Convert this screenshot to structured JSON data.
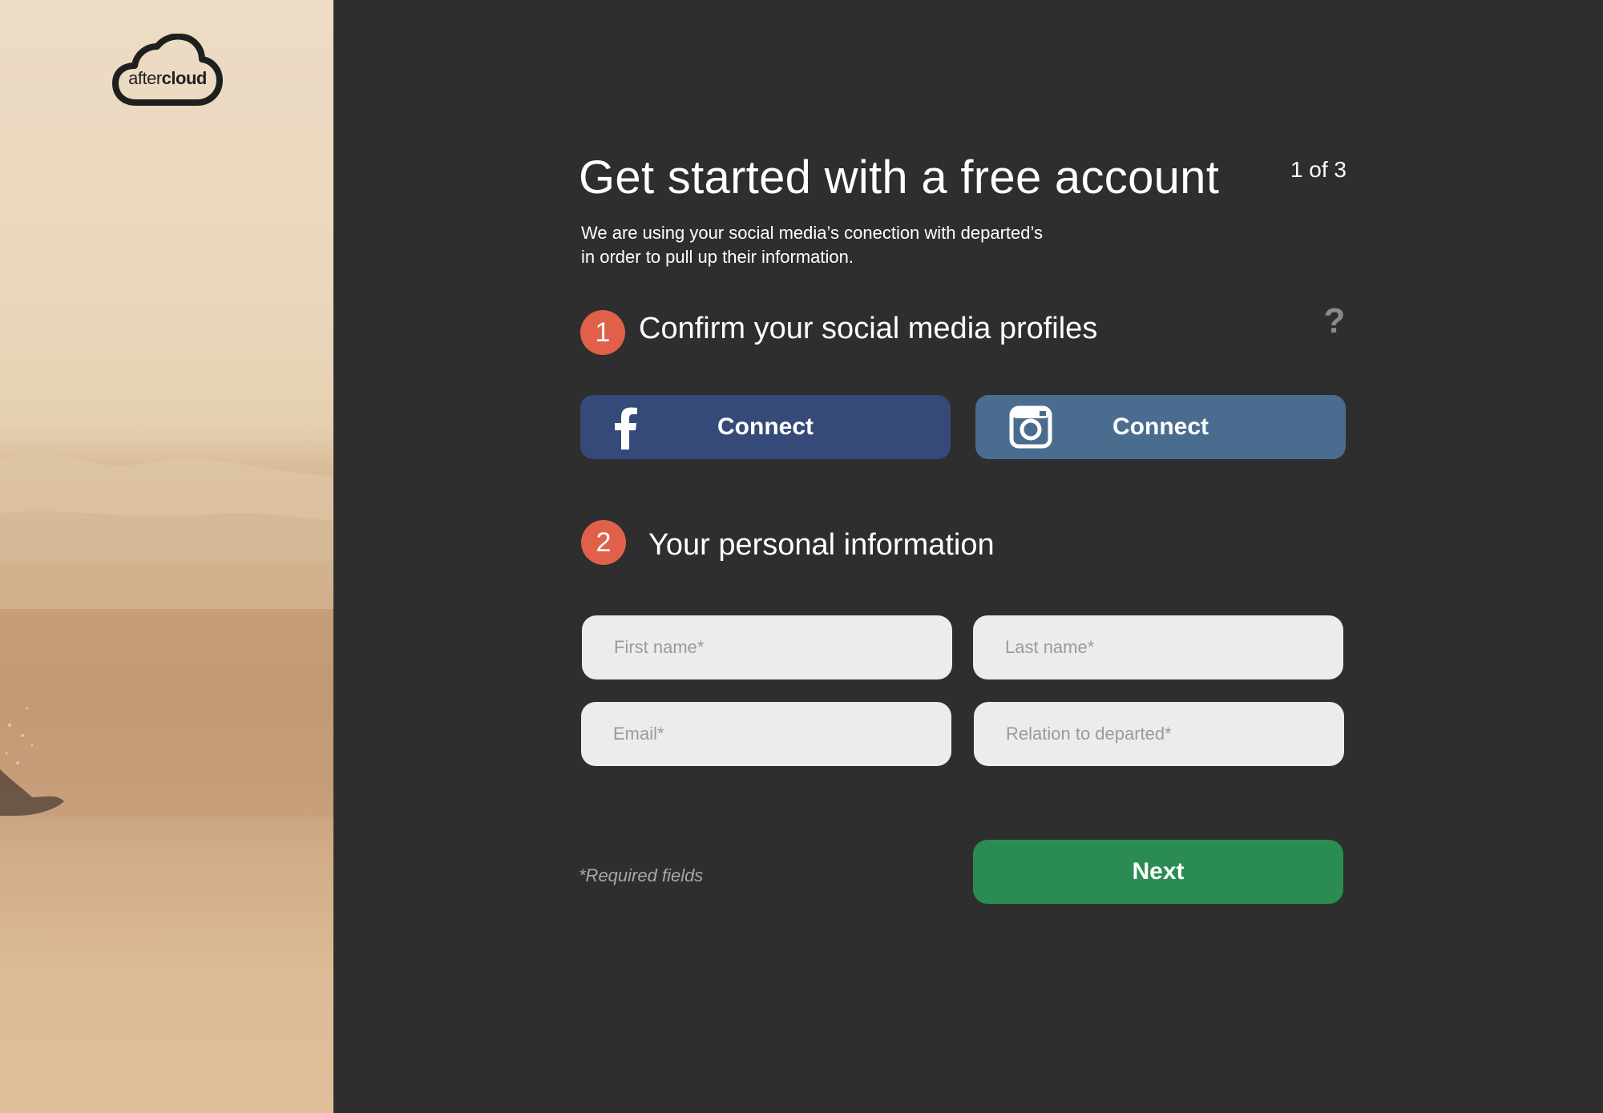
{
  "brand": {
    "logo_text_light": "after",
    "logo_text_bold": "cloud"
  },
  "header": {
    "title": "Get started with a free account",
    "step_counter": "1 of 3",
    "subtitle_line1": "We are using your social media’s conection with departed’s",
    "subtitle_line2": "in order to pull up their information."
  },
  "section1": {
    "number": "1",
    "heading": "Confirm your social media profiles",
    "help_icon": "?",
    "facebook_label": "Connect",
    "instagram_label": "Connect"
  },
  "section2": {
    "number": "2",
    "heading": "Your personal information",
    "fields": {
      "first_name_placeholder": "First name*",
      "last_name_placeholder": "Last name*",
      "email_placeholder": "Email*",
      "relation_placeholder": "Relation to departed*"
    }
  },
  "footer": {
    "required_note": "*Required fields",
    "next_label": "Next"
  },
  "colors": {
    "background": "#2e2e2e",
    "accent_step": "#e0604a",
    "facebook": "#354a78",
    "instagram": "#4a6d8f",
    "next": "#2a8c52",
    "field_bg": "#ececec"
  }
}
